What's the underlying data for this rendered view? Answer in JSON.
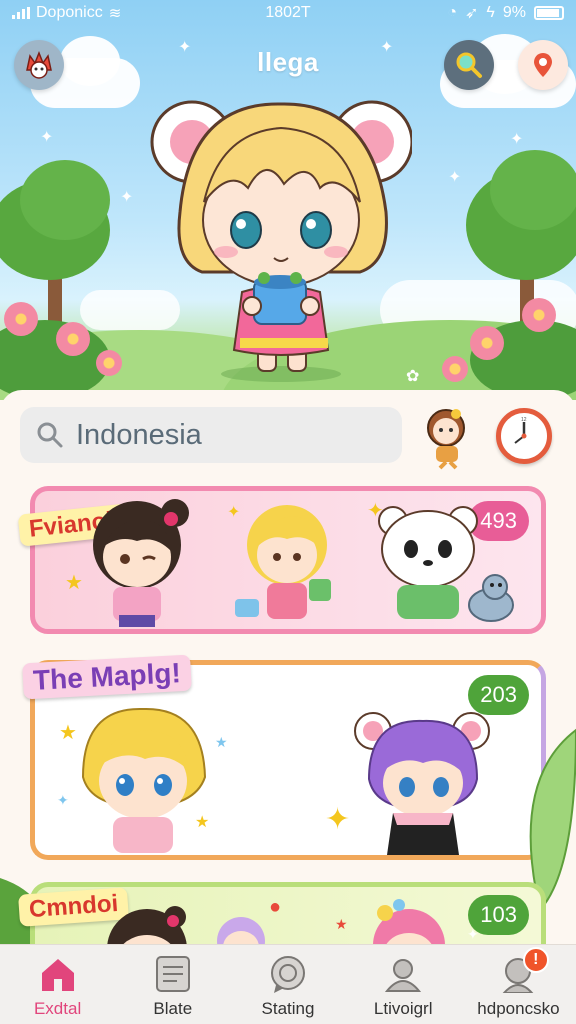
{
  "status_bar": {
    "carrier": "Doponicc",
    "time": "1802T",
    "battery": "9%",
    "battery_level": 0.9
  },
  "header": {
    "title": "llega",
    "search_icon": "search-icon",
    "pin_icon": "map-pin-icon",
    "logo_icon": "app-logo-icon"
  },
  "search": {
    "value": "Indonesia"
  },
  "cards": [
    {
      "label": "Fvianoil",
      "count": "493",
      "colors": {
        "border": "#f28ab0",
        "count_bg": "#e85d97",
        "label_bg": "#fff2a8",
        "label_text": "#d8372d"
      }
    },
    {
      "label": "The Maplg!",
      "count": "203",
      "colors": {
        "border": "#f1a85a",
        "count_bg": "#4fa43a",
        "label_bg": "#fbd1e4",
        "label_text": "#7a3fb5"
      }
    },
    {
      "label": "Cmndoi",
      "count": "103",
      "colors": {
        "border": "#b9de7a",
        "count_bg": "#4fa43a",
        "label_bg": "#fff2a8",
        "label_text": "#d8372d"
      }
    }
  ],
  "bottom_nav": [
    {
      "label": "Exdtal",
      "icon": "home-icon",
      "active": true
    },
    {
      "label": "Blate",
      "icon": "document-icon",
      "active": false
    },
    {
      "label": "Stating",
      "icon": "chat-bubble-icon",
      "active": false
    },
    {
      "label": "Ltivoigrl",
      "icon": "user-icon",
      "active": false
    },
    {
      "label": "hdponcsko",
      "icon": "profile-icon",
      "active": false,
      "badge": "!"
    }
  ],
  "colors": {
    "accent": "#e1457c",
    "sky": "#8fd0f4",
    "grass": "#9cd67e"
  }
}
